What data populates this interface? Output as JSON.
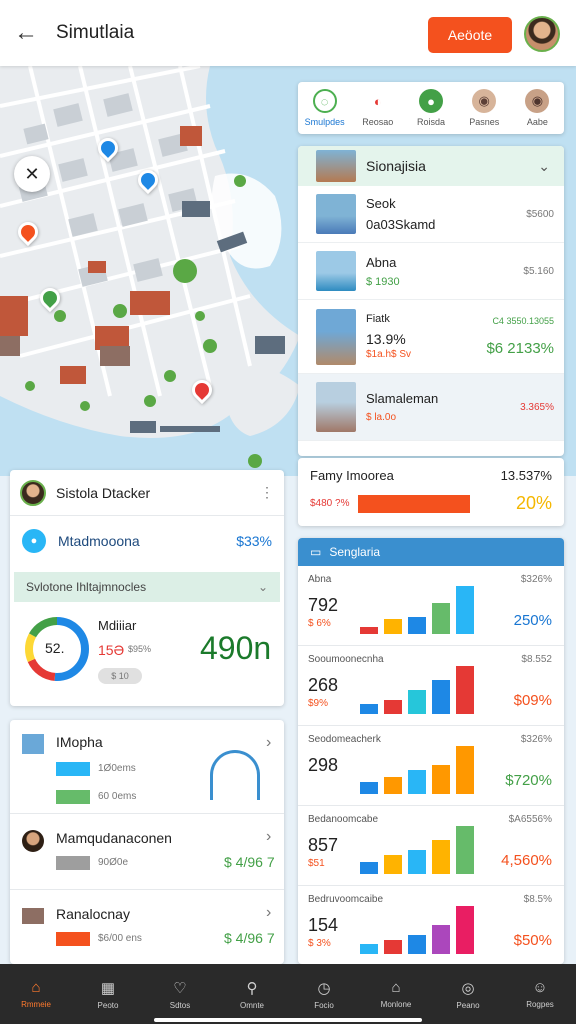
{
  "header": {
    "title": "Simutlaia",
    "back_icon": "←",
    "action_label": "Aeöote"
  },
  "tabs": [
    {
      "label": "Smulpdes",
      "icon": "◌",
      "color": "#4caf50"
    },
    {
      "label": "Reosao",
      "icon": "◐",
      "color": "#e53935"
    },
    {
      "label": "Roisda",
      "icon": "●",
      "color": "#43a047"
    },
    {
      "label": "Pasnes",
      "icon": "◉",
      "color": "#8d6e63"
    },
    {
      "label": "Aabe",
      "icon": "◉",
      "color": "#6d4c41"
    }
  ],
  "destinations": {
    "header": "Sionajisia",
    "items": [
      {
        "name": "Seok",
        "sub": "0a03Skamd",
        "right_top": "$5600",
        "color": "#4a7ab8"
      },
      {
        "name": "Abna",
        "sub": "$ 1930",
        "right_top": "$5.160",
        "color": "#6aa8d8"
      },
      {
        "name": "Fiatk",
        "name2": "13.9%",
        "sub": "$1a.h$ Sv",
        "right_top": "C4 3550.13055",
        "right_big": "$6 2133%",
        "color": "#b08a6a"
      },
      {
        "name": "Slamaleman",
        "sub": "$ la.0o",
        "right_top": "3.365%",
        "color": "#a07868"
      }
    ]
  },
  "family": {
    "title": "Famy Imoorea",
    "value": "13.537%",
    "sub": "$480 ?%",
    "pct": "20%"
  },
  "stats": {
    "header": "Senglaria",
    "rows": [
      {
        "label": "Abna",
        "big": "792",
        "sub": "$ 6%",
        "tr": "$326%",
        "pct": "250%",
        "pct_color": "#1976d2",
        "values": [
          3,
          7,
          8,
          14,
          22
        ],
        "colors": [
          "#e53935",
          "#ffb300",
          "#1e88e5",
          "#66bb6a",
          "#29b6f6"
        ]
      },
      {
        "label": "Sooumoonecnha",
        "big": "268",
        "sub": "$9%",
        "tr": "$8.552",
        "pct": "$09%",
        "pct_color": "#f4511e",
        "values": [
          4,
          6,
          10,
          14,
          20
        ],
        "colors": [
          "#1e88e5",
          "#e53935",
          "#26c6da",
          "#1e88e5",
          "#e53935"
        ]
      },
      {
        "label": "Seodomeacherk",
        "big": "298",
        "sub": "",
        "tr": "$326%",
        "pct": "$720%",
        "pct_color": "#43a047",
        "values": [
          5,
          7,
          10,
          12,
          20
        ],
        "colors": [
          "#1e88e5",
          "#ff9800",
          "#29b6f6",
          "#ff9800",
          "#ff9800"
        ]
      },
      {
        "label": "Bedanoomcabe",
        "big": "857",
        "sub": "$51",
        "tr": "$A6556%",
        "pct": "4,560%",
        "pct_color": "#f4511e",
        "values": [
          5,
          8,
          10,
          14,
          20
        ],
        "colors": [
          "#1e88e5",
          "#ffb300",
          "#29b6f6",
          "#ffb300",
          "#66bb6a"
        ]
      },
      {
        "label": "Bedruvoomcaibe",
        "big": "154",
        "sub": "$ 3%",
        "tr": "$8.5%",
        "pct": "$50%",
        "pct_color": "#f4511e",
        "values": [
          4,
          6,
          8,
          12,
          20
        ],
        "colors": [
          "#29b6f6",
          "#e53935",
          "#1e88e5",
          "#ab47bc",
          "#e91e63"
        ]
      }
    ]
  },
  "seller": {
    "title": "Sistola Dtacker",
    "row1_label": "Mtadmooona",
    "row1_value": "$33%",
    "row2_label": "Svlotone Ihltajmnocles",
    "gauge_label": "Mdiiiar",
    "gauge_center": "52.",
    "gauge_value": "15Ə",
    "gauge_sub": "$95%",
    "big": "490n",
    "pill": "$ 10"
  },
  "list": [
    {
      "title": "IMopha",
      "line1": "1Ø0ems",
      "line2": "60 0ems",
      "line1_color": "#29b6f6",
      "line2_color": "#66bb6a",
      "value": ""
    },
    {
      "title": "Mamqudanaconen",
      "line1": "90Ø0e",
      "line2": "",
      "line1_color": "#9e9e9e",
      "line2_color": "",
      "value": "$ 4/96 7"
    },
    {
      "title": "Ranalocnay",
      "line1": "$6/00 ens",
      "line2": "",
      "line1_color": "#f4511e",
      "line2_color": "",
      "value": "$ 4/96 7"
    }
  ],
  "bottom_nav": [
    {
      "label": "Rmmeie",
      "icon": "⌂",
      "active": true
    },
    {
      "label": "Peoto",
      "icon": "▦",
      "active": false
    },
    {
      "label": "Sdtos",
      "icon": "♡",
      "active": false
    },
    {
      "label": "Omnte",
      "icon": "⚲",
      "active": false
    },
    {
      "label": "Focio",
      "icon": "◷",
      "active": false
    },
    {
      "label": "Monlone",
      "icon": "⌂",
      "active": false
    },
    {
      "label": "Peano",
      "icon": "◎",
      "active": false
    },
    {
      "label": "Rogpes",
      "icon": "☺",
      "active": false
    }
  ]
}
